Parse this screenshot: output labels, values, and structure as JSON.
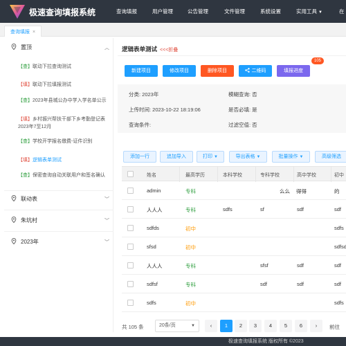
{
  "app": {
    "title": "极速查询填报系统",
    "menu": [
      {
        "label": "查询填报",
        "dropdown": false
      },
      {
        "label": "用户管理",
        "dropdown": false
      },
      {
        "label": "公告管理",
        "dropdown": false
      },
      {
        "label": "文件管理",
        "dropdown": false
      },
      {
        "label": "系统设置",
        "dropdown": false
      },
      {
        "label": "实用工具",
        "dropdown": true
      },
      {
        "label": "在",
        "dropdown": false
      }
    ]
  },
  "tabs": [
    {
      "label": "查询填报",
      "close": "×"
    }
  ],
  "sidebar": {
    "groups": [
      {
        "label": "置顶",
        "chevron": "︿"
      },
      {
        "label": "联动表",
        "chevron": "﹀"
      },
      {
        "label": "朱坑村",
        "chevron": "﹀"
      },
      {
        "label": "2023年",
        "chevron": "﹀"
      }
    ],
    "items": [
      {
        "tag": "【查】",
        "text": "联动下拉查询测试"
      },
      {
        "tag": "【填】",
        "text": "联动下拉填报测试"
      },
      {
        "tag": "【查】",
        "text": "2023年县城公办中学入学名单公示"
      },
      {
        "tag": "【填】",
        "text": "乡村振兴帮扶干部下乡考勤登记表2023年7至12月"
      },
      {
        "tag": "【查】",
        "text": "学校开学报名缴费-证件识别"
      },
      {
        "tag": "【填】",
        "text": "逻辑表单测试"
      },
      {
        "tag": "【查】",
        "text": "保密查询自动关联用户和签名确认"
      }
    ]
  },
  "panel": {
    "title": "逻辑表单测试",
    "fold": "<<<折叠",
    "buttons": {
      "new": "新建项目",
      "edit": "修改项目",
      "delete": "删除项目",
      "qrcode": "二维码",
      "progress": "填报进度",
      "progress_badge": "105"
    },
    "info": {
      "category": "分类: 2023年",
      "fuzzy": "模糊查询: 否",
      "upload_time": "上传时间: 2023-10-22 18:19:06",
      "required": "是否必填: 是",
      "conditions": "查询条件:",
      "filter_empty": "过滤空值: 否"
    },
    "toolbar": {
      "add_row": "添加一行",
      "import": "追加导入",
      "print": "打印",
      "export": "导出表格",
      "batch": "批量操作",
      "advanced": "高级筛选"
    }
  },
  "table": {
    "columns": [
      "姓名",
      "最高学历",
      "本科学校",
      "专科学校",
      "高中学校",
      "初中"
    ],
    "rows": [
      [
        "admin",
        "专科",
        "",
        "么么",
        "得得",
        "的"
      ],
      [
        "人人人",
        "专科",
        "sdfs",
        "sf",
        "sdf",
        "sdf"
      ],
      [
        "sdfds",
        "初中",
        "",
        "",
        "",
        "sdfs"
      ],
      [
        "sfsd",
        "初中",
        "",
        "",
        "",
        "sdfsd"
      ],
      [
        "人人人",
        "专科",
        "",
        "sfsf",
        "sdf",
        "sdf"
      ],
      [
        "sdfsf",
        "专科",
        "",
        "sdf",
        "sdf",
        "sdf"
      ],
      [
        "sdfs",
        "初中",
        "",
        "",
        "",
        "sdfs"
      ]
    ]
  },
  "pagination": {
    "total": "共 105 条",
    "page_size": "20条/页",
    "prev": "‹",
    "pages": [
      "1",
      "2",
      "3",
      "4",
      "5",
      "6"
    ],
    "current": "1",
    "next": "›",
    "goto": "前往"
  },
  "footer": {
    "text": "极速查询填报系统 版权所有 ©2023"
  },
  "colors": {
    "topbar": "#2f3640",
    "primary": "#1e9fff",
    "danger": "#ff5722",
    "purple": "#7b68ee",
    "green": "#2e9e3e",
    "orange": "#ff9900"
  }
}
